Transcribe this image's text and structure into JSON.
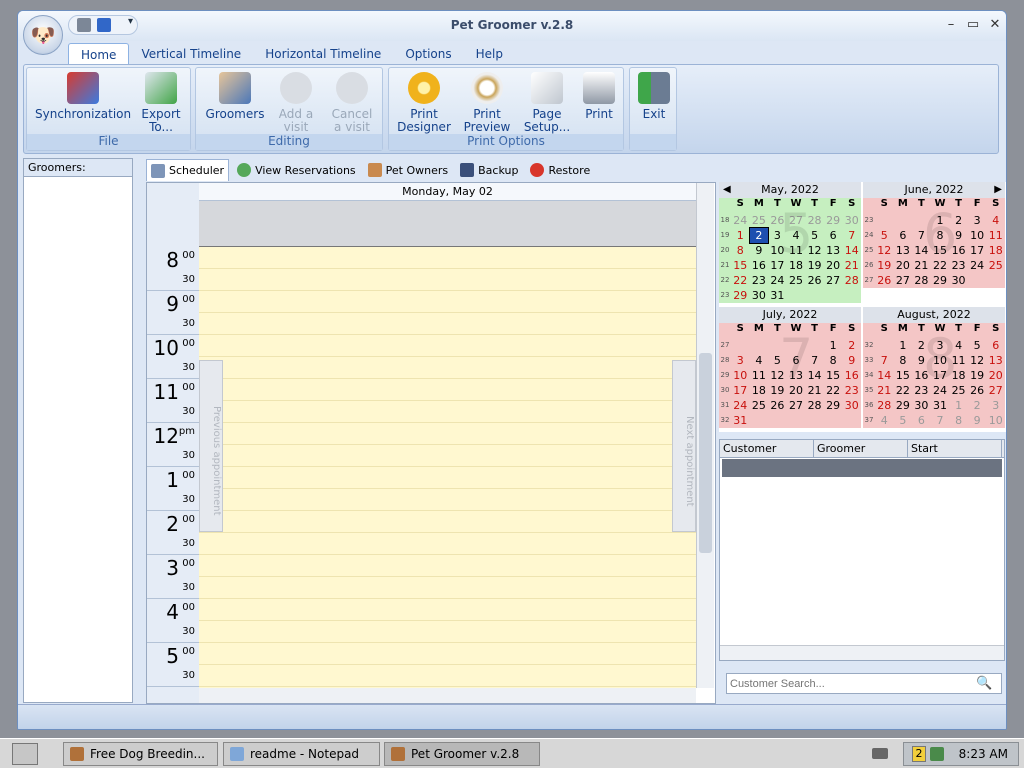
{
  "window": {
    "title": "Pet Groomer v.2.8"
  },
  "ribbon": {
    "tabs": [
      "Home",
      "Vertical Timeline",
      "Horizontal Timeline",
      "Options",
      "Help"
    ],
    "groups": [
      {
        "label": "File",
        "buttons": [
          "Synchronization",
          "Export\nTo..."
        ]
      },
      {
        "label": "Editing",
        "buttons": [
          "Groomers",
          "Add a\nvisit",
          "Cancel\na visit"
        ]
      },
      {
        "label": "Print Options",
        "buttons": [
          "Print\nDesigner",
          "Print\nPreview",
          "Page\nSetup...",
          "Print"
        ]
      },
      {
        "label": "",
        "buttons": [
          "Exit"
        ]
      }
    ]
  },
  "groomers": {
    "header": "Groomers:"
  },
  "subtabs": [
    "Scheduler",
    "View Reservations",
    "Pet Owners",
    "Backup",
    "Restore"
  ],
  "scheduler": {
    "date": "Monday, May 02",
    "hours": [
      {
        "h": "8",
        "sub": "00"
      },
      {
        "h": "9",
        "sub": "00"
      },
      {
        "h": "10",
        "sub": "00"
      },
      {
        "h": "11",
        "sub": "00"
      },
      {
        "h": "12",
        "sub": "pm"
      },
      {
        "h": "1",
        "sub": "00"
      },
      {
        "h": "2",
        "sub": "00"
      },
      {
        "h": "3",
        "sub": "00"
      },
      {
        "h": "4",
        "sub": "00"
      },
      {
        "h": "5",
        "sub": "00"
      }
    ],
    "half": "30",
    "prev": "Previous appointment",
    "next": "Next appointment"
  },
  "calendar": {
    "dow": [
      "S",
      "M",
      "T",
      "W",
      "T",
      "F",
      "S"
    ],
    "months": [
      {
        "title": "May, 2022",
        "big": "5",
        "color": "green",
        "weeks": [
          {
            "n": "18",
            "d": [
              "24",
              "25",
              "26",
              "27",
              "28",
              "29",
              "30"
            ]
          },
          {
            "n": "19",
            "d": [
              "1",
              "2",
              "3",
              "4",
              "5",
              "6",
              "7"
            ]
          },
          {
            "n": "20",
            "d": [
              "8",
              "9",
              "10",
              "11",
              "12",
              "13",
              "14"
            ]
          },
          {
            "n": "21",
            "d": [
              "15",
              "16",
              "17",
              "18",
              "19",
              "20",
              "21"
            ]
          },
          {
            "n": "22",
            "d": [
              "22",
              "23",
              "24",
              "25",
              "26",
              "27",
              "28"
            ]
          },
          {
            "n": "23",
            "d": [
              "29",
              "30",
              "31",
              "",
              "",
              "",
              ""
            ]
          }
        ]
      },
      {
        "title": "June, 2022",
        "big": "6",
        "color": "pink",
        "weeks": [
          {
            "n": "23",
            "d": [
              "",
              "",
              "",
              "1",
              "2",
              "3",
              "4"
            ]
          },
          {
            "n": "24",
            "d": [
              "5",
              "6",
              "7",
              "8",
              "9",
              "10",
              "11"
            ]
          },
          {
            "n": "25",
            "d": [
              "12",
              "13",
              "14",
              "15",
              "16",
              "17",
              "18"
            ]
          },
          {
            "n": "26",
            "d": [
              "19",
              "20",
              "21",
              "22",
              "23",
              "24",
              "25"
            ]
          },
          {
            "n": "27",
            "d": [
              "26",
              "27",
              "28",
              "29",
              "30",
              "",
              ""
            ]
          }
        ]
      },
      {
        "title": "July, 2022",
        "big": "7",
        "color": "pink",
        "weeks": [
          {
            "n": "27",
            "d": [
              "",
              "",
              "",
              "",
              "",
              "1",
              "2"
            ]
          },
          {
            "n": "28",
            "d": [
              "3",
              "4",
              "5",
              "6",
              "7",
              "8",
              "9"
            ]
          },
          {
            "n": "29",
            "d": [
              "10",
              "11",
              "12",
              "13",
              "14",
              "15",
              "16"
            ]
          },
          {
            "n": "30",
            "d": [
              "17",
              "18",
              "19",
              "20",
              "21",
              "22",
              "23"
            ]
          },
          {
            "n": "31",
            "d": [
              "24",
              "25",
              "26",
              "27",
              "28",
              "29",
              "30"
            ]
          },
          {
            "n": "32",
            "d": [
              "31",
              "",
              "",
              "",
              "",
              "",
              ""
            ]
          }
        ]
      },
      {
        "title": "August, 2022",
        "big": "8",
        "color": "pink",
        "weeks": [
          {
            "n": "32",
            "d": [
              "",
              "1",
              "2",
              "3",
              "4",
              "5",
              "6"
            ]
          },
          {
            "n": "33",
            "d": [
              "7",
              "8",
              "9",
              "10",
              "11",
              "12",
              "13"
            ]
          },
          {
            "n": "34",
            "d": [
              "14",
              "15",
              "16",
              "17",
              "18",
              "19",
              "20"
            ]
          },
          {
            "n": "35",
            "d": [
              "21",
              "22",
              "23",
              "24",
              "25",
              "26",
              "27"
            ]
          },
          {
            "n": "36",
            "d": [
              "28",
              "29",
              "30",
              "31",
              "1",
              "2",
              "3"
            ]
          },
          {
            "n": "37",
            "d": [
              "4",
              "5",
              "6",
              "7",
              "8",
              "9",
              "10"
            ]
          }
        ]
      }
    ]
  },
  "grid": {
    "columns": [
      "Customer",
      "Groomer",
      "Start"
    ]
  },
  "search": {
    "placeholder": "Customer Search..."
  },
  "taskbar": {
    "items": [
      "Free Dog Breedin...",
      "readme - Notepad",
      "Pet Groomer v.2.8"
    ],
    "tray_badge": "2",
    "clock": "8:23 AM"
  }
}
